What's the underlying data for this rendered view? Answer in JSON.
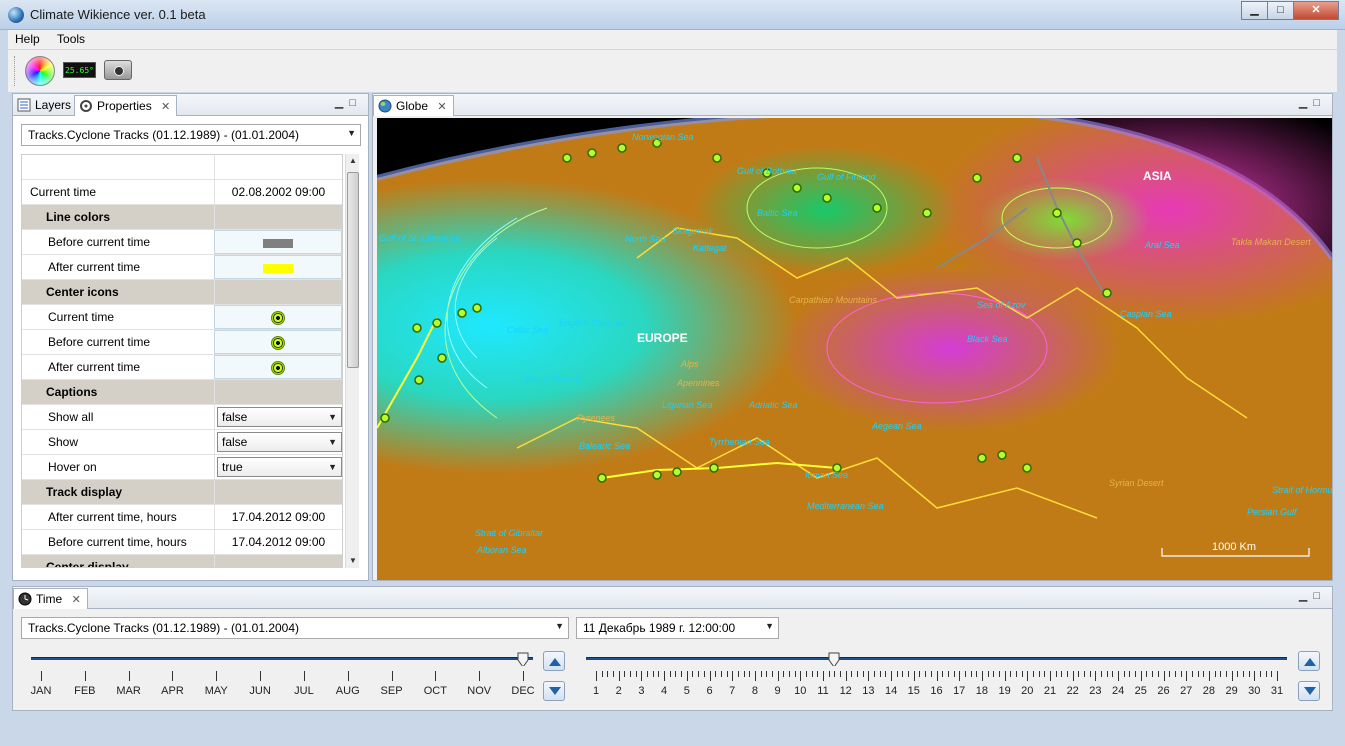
{
  "window": {
    "title": "Climate Wikience ver. 0.1 beta",
    "buttons": {
      "minimize": "▁",
      "maximize": "□",
      "close": "✕"
    }
  },
  "menu": [
    {
      "label": "Help"
    },
    {
      "label": "Tools"
    }
  ],
  "toolbar": {
    "temperature": "25.65°"
  },
  "left_panel": {
    "tabs": [
      {
        "label": "Layers"
      },
      {
        "label": "Properties"
      }
    ],
    "layer_select": "Tracks.Cyclone Tracks  (01.12.1989)  -  (01.01.2004)",
    "properties": [
      {
        "kind": "empty",
        "key": "",
        "value": ""
      },
      {
        "kind": "plain",
        "key": "Current time",
        "value": "02.08.2002 09:00"
      },
      {
        "kind": "group",
        "key": "Line colors"
      },
      {
        "kind": "swatch",
        "key": "Before current time",
        "color": "#808080"
      },
      {
        "kind": "swatch",
        "key": "After current time",
        "color": "#ffff00"
      },
      {
        "kind": "group",
        "key": "Center icons"
      },
      {
        "kind": "icon",
        "key": "Current time"
      },
      {
        "kind": "icon",
        "key": "Before current time"
      },
      {
        "kind": "icon",
        "key": "After current time"
      },
      {
        "kind": "group",
        "key": "Captions"
      },
      {
        "kind": "select",
        "key": "Show all",
        "value": "false"
      },
      {
        "kind": "select",
        "key": "Show",
        "value": "false"
      },
      {
        "kind": "select",
        "key": "Hover on",
        "value": "true"
      },
      {
        "kind": "group",
        "key": "Track display"
      },
      {
        "kind": "plain",
        "key": "After current time, hours",
        "value": "17.04.2012 09:00"
      },
      {
        "kind": "plain",
        "key": "Before current time, hours",
        "value": "17.04.2012 09:00"
      },
      {
        "kind": "group",
        "key": "Center display"
      }
    ]
  },
  "globe_panel": {
    "tab": "Globe",
    "scale_label": "1000 Km",
    "labels": {
      "europe": "EUROPE",
      "asia": "ASIA",
      "norwegian_sea": "Norwegian Sea",
      "gulf_bothnia": "Gulf of Bothnia",
      "gulf_finland": "Gulf of Finland",
      "baltic": "Baltic Sea",
      "north_sea": "North Sea",
      "skagerrak": "Skagerrak",
      "kattegat": "Kattegat",
      "st_lawrence": "Gulf of St. Lawrence",
      "celtic": "Celtic Sea",
      "english_channel": "English Channel",
      "biscay": "Bay of Biscay",
      "alps": "Alps",
      "apennines": "Apennines",
      "pyrenees": "Pyrenees",
      "carpathian": "Carpathian Mountains",
      "azov": "Sea of Azov",
      "black_sea": "Black Sea",
      "caspian": "Caspian Sea",
      "aral": "Aral Sea",
      "taklamakan": "Takla Makan Desert",
      "ligurian": "Ligurian Sea",
      "adriatic": "Adriatic Sea",
      "aegean": "Aegean Sea",
      "balearic": "Balearic Sea",
      "tyrrhenian": "Tyrrhenian Sea",
      "ionian": "Ionian Sea",
      "mediterranean": "Mediterranean Sea",
      "syrian": "Syrian Desert",
      "hormuz": "Strait of Hormuz",
      "persian": "Persian Gulf",
      "gibraltar": "Strait of Gibraltar",
      "alboran": "Alboran Sea"
    }
  },
  "time_panel": {
    "tab": "Time",
    "layer_select": "Tracks.Cyclone Tracks  (01.12.1989)  -  (01.01.2004)",
    "date_select": "11 Декабрь 1989 г. 12:00:00",
    "months": [
      "JAN",
      "FEB",
      "MAR",
      "APR",
      "MAY",
      "JUN",
      "JUL",
      "AUG",
      "SEP",
      "OCT",
      "NOV",
      "DEC"
    ],
    "month_slider_value": 12,
    "days": [
      "1",
      "2",
      "3",
      "4",
      "5",
      "6",
      "7",
      "8",
      "9",
      "10",
      "11",
      "12",
      "13",
      "14",
      "15",
      "16",
      "17",
      "18",
      "19",
      "20",
      "21",
      "22",
      "23",
      "24",
      "25",
      "26",
      "27",
      "28",
      "29",
      "30",
      "31"
    ],
    "day_slider_value": 11.5
  }
}
